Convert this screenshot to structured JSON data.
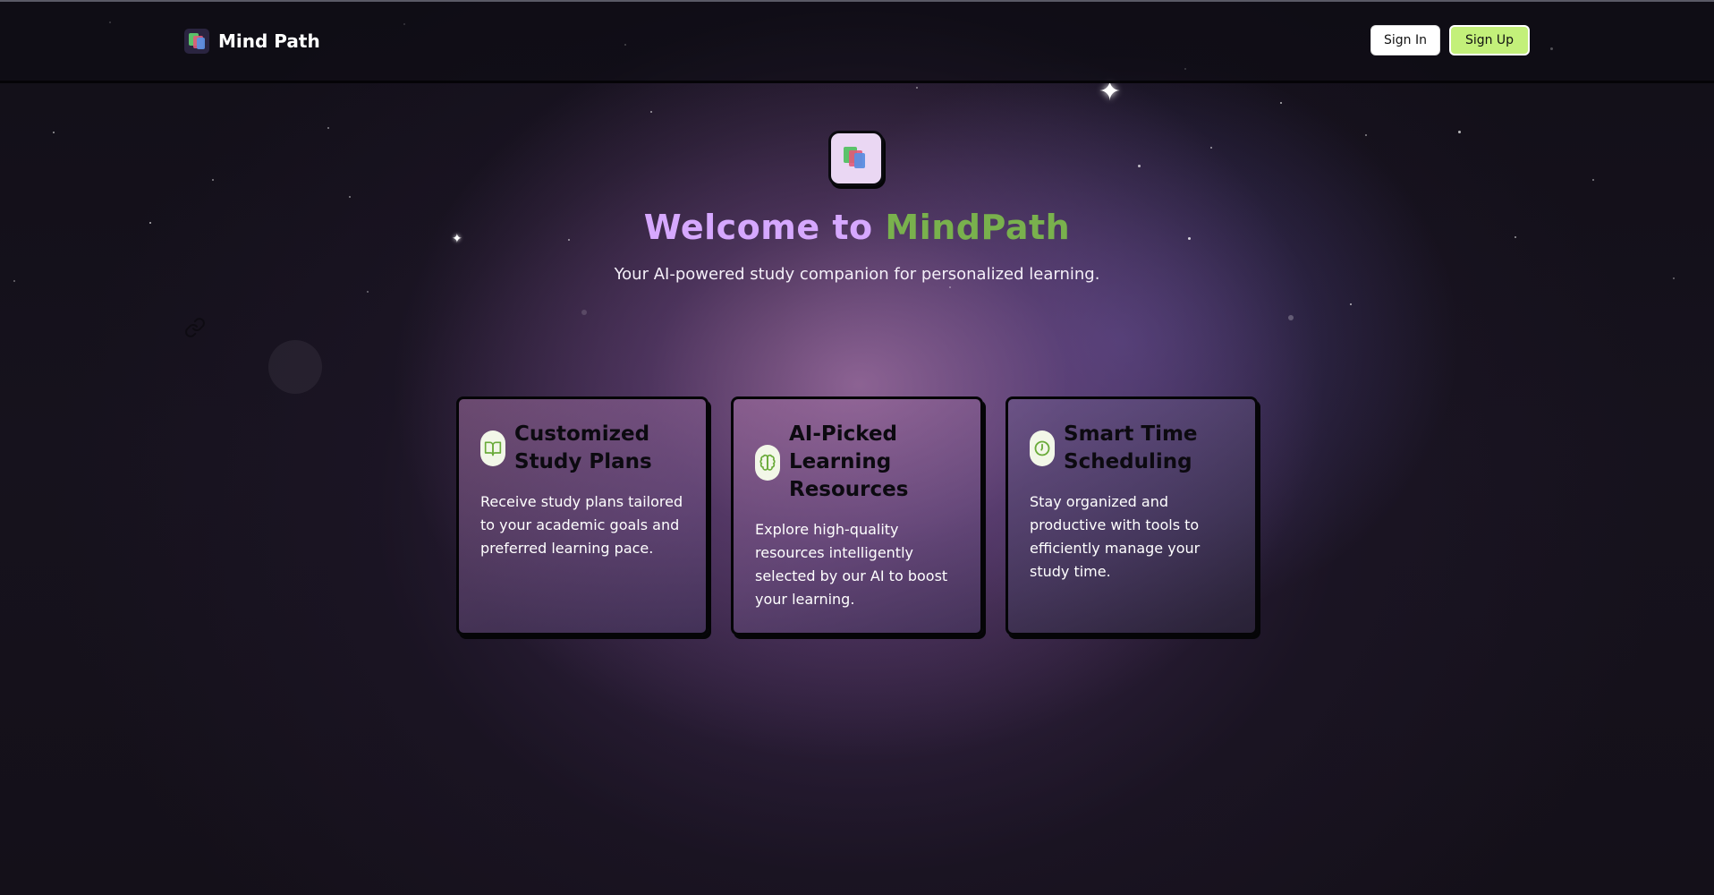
{
  "header": {
    "brand_name": "Mind Path",
    "sign_in_label": "Sign In",
    "sign_up_label": "Sign Up"
  },
  "hero": {
    "title_part1": "Welcome to",
    "title_part2": "MindPath",
    "subtitle": "Your AI-powered study companion for personalized learning."
  },
  "features": [
    {
      "icon": "book-open-icon",
      "title": "Customized Study Plans",
      "description": "Receive study plans tailored to your academic goals and preferred learning pace."
    },
    {
      "icon": "brain-icon",
      "title": "AI-Picked Learning Resources",
      "description": "Explore high-quality resources intelligently selected by our AI to boost your learning."
    },
    {
      "icon": "clock-icon",
      "title": "Smart Time Scheduling",
      "description": "Stay organized and productive with tools to efficiently manage your study time."
    }
  ],
  "colors": {
    "accent_purple": "#d6a8ff",
    "accent_green": "#79b14d",
    "signup_button": "#c3f07a",
    "background": "#141019"
  }
}
